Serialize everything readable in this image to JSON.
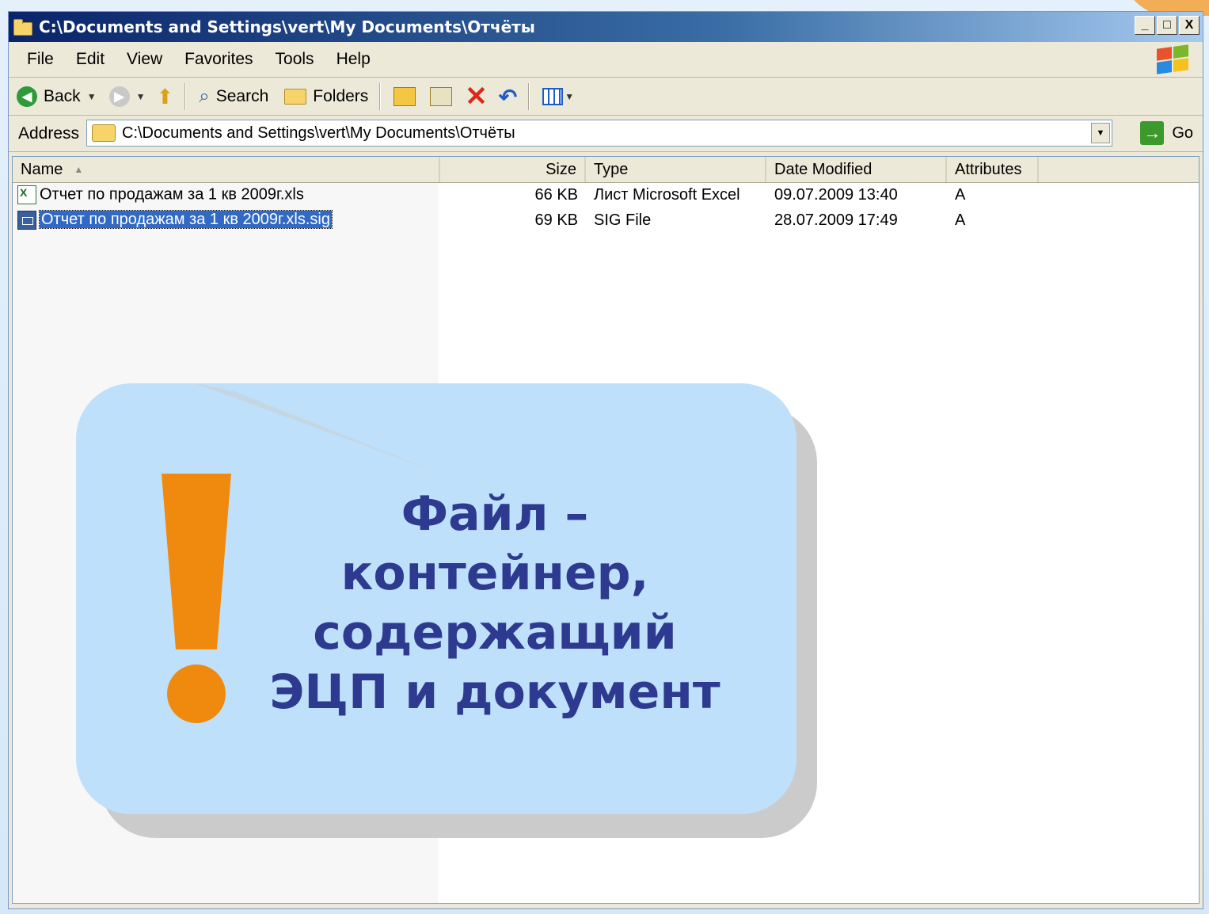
{
  "window": {
    "title": "C:\\Documents and Settings\\vert\\My Documents\\Отчёты",
    "controls": [
      "_",
      "□",
      "X"
    ]
  },
  "menu": {
    "items": [
      "File",
      "Edit",
      "View",
      "Favorites",
      "Tools",
      "Help"
    ]
  },
  "toolbar": {
    "back_label": "Back",
    "search_label": "Search",
    "folders_label": "Folders"
  },
  "address": {
    "label": "Address",
    "value": "C:\\Documents and Settings\\vert\\My Documents\\Отчёты",
    "go_label": "Go"
  },
  "list": {
    "columns": [
      "Name",
      "Size",
      "Type",
      "Date Modified",
      "Attributes"
    ],
    "rows": [
      {
        "name": "Отчет по продажам за 1 кв 2009г.xls",
        "size": "66 KB",
        "type": "Лист Microsoft Excel",
        "modified": "09.07.2009 13:40",
        "attributes": "A",
        "icon": "excel-file-icon"
      },
      {
        "name": "Отчет по продажам за 1 кв 2009г.xls.sig",
        "size": "69 KB",
        "type": "SIG File",
        "modified": "28.07.2009 17:49",
        "attributes": "A",
        "icon": "sig-file-icon"
      }
    ]
  },
  "callout": {
    "line1": "Файл –",
    "line2": "контейнер,",
    "line3": "содержащий",
    "line4": "ЭЦП и документ"
  },
  "colors": {
    "callout_bg": "#bfe0fb",
    "callout_text": "#2e3a8f",
    "exclamation": "#ef8a0e",
    "selection": "#316ac5"
  }
}
